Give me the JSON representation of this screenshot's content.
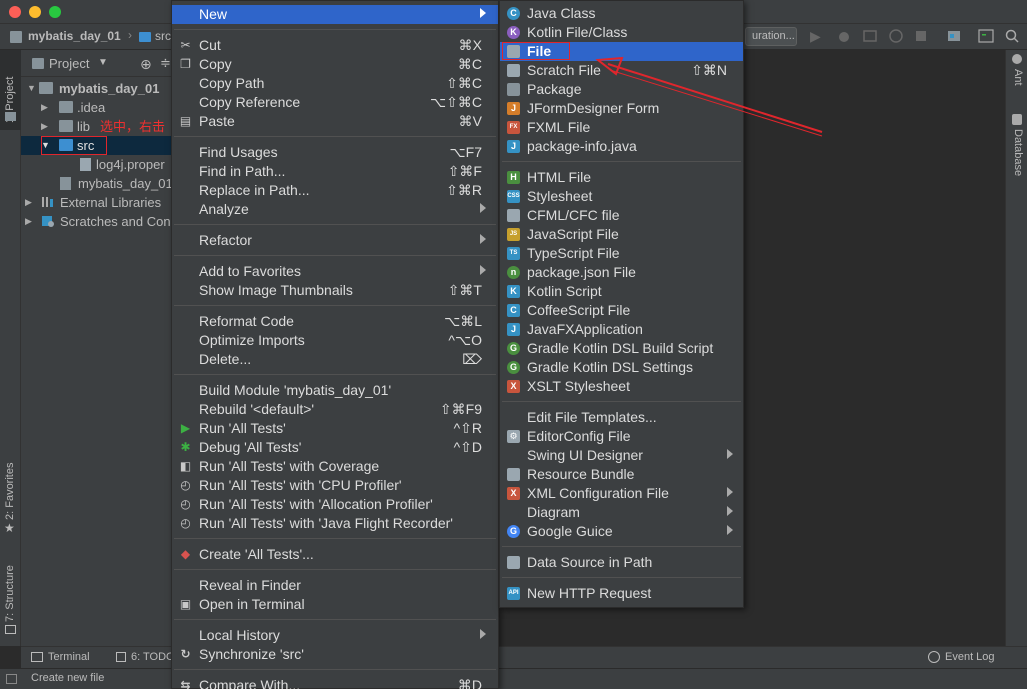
{
  "window": {
    "breadcrumb_project": "mybatis_day_01",
    "breadcrumb_folder": "src",
    "run_config_label": "uration..."
  },
  "left_tool_tabs": [
    "1: Project",
    "2: Favorites",
    "7: Structure"
  ],
  "right_tool_tabs": [
    "Ant",
    "Database"
  ],
  "project_panel": {
    "title": "Project",
    "tree": [
      {
        "label": "mybatis_day_01",
        "depth": 0,
        "expanded": true,
        "bold": true
      },
      {
        "label": ".idea",
        "depth": 1,
        "expanded": false
      },
      {
        "label": "lib",
        "depth": 1,
        "expanded": false
      },
      {
        "label": "src",
        "depth": 1,
        "expanded": true,
        "selected": true
      },
      {
        "label": "log4j.proper",
        "depth": 2
      },
      {
        "label": "mybatis_day_01",
        "depth": 1
      },
      {
        "label": "External Libraries",
        "depth": 0,
        "expanded": false
      },
      {
        "label": "Scratches and Con",
        "depth": 0,
        "expanded": false
      }
    ]
  },
  "annotation_text": "选中，右击",
  "context_menu": {
    "items": [
      {
        "label": "New",
        "shortcut": "",
        "submenu": true,
        "highlighted": true
      },
      {
        "sep": true
      },
      {
        "label": "Cut",
        "shortcut": "⌘X",
        "icon": "scissors-icon"
      },
      {
        "label": "Copy",
        "shortcut": "⌘C",
        "icon": "copy-icon"
      },
      {
        "label": "Copy Path",
        "shortcut": "⇧⌘C"
      },
      {
        "label": "Copy Reference",
        "shortcut": "⌥⇧⌘C"
      },
      {
        "label": "Paste",
        "shortcut": "⌘V",
        "icon": "paste-icon"
      },
      {
        "sep": true
      },
      {
        "label": "Find Usages",
        "shortcut": "⌥F7"
      },
      {
        "label": "Find in Path...",
        "shortcut": "⇧⌘F"
      },
      {
        "label": "Replace in Path...",
        "shortcut": "⇧⌘R"
      },
      {
        "label": "Analyze",
        "shortcut": "",
        "submenu": true
      },
      {
        "sep": true
      },
      {
        "label": "Refactor",
        "shortcut": "",
        "submenu": true
      },
      {
        "sep": true
      },
      {
        "label": "Add to Favorites",
        "shortcut": "",
        "submenu": true
      },
      {
        "label": "Show Image Thumbnails",
        "shortcut": "⇧⌘T"
      },
      {
        "sep": true
      },
      {
        "label": "Reformat Code",
        "shortcut": "⌥⌘L"
      },
      {
        "label": "Optimize Imports",
        "shortcut": "^⌥O"
      },
      {
        "label": "Delete...",
        "shortcut": "⌦"
      },
      {
        "sep": true
      },
      {
        "label": "Build Module 'mybatis_day_01'",
        "shortcut": ""
      },
      {
        "label": "Rebuild '<default>'",
        "shortcut": "⇧⌘F9"
      },
      {
        "label": "Run 'All Tests'",
        "shortcut": "^⇧R",
        "icon": "run-icon"
      },
      {
        "label": "Debug 'All Tests'",
        "shortcut": "^⇧D",
        "icon": "debug-icon"
      },
      {
        "label": "Run 'All Tests' with Coverage",
        "shortcut": "",
        "icon": "coverage-icon"
      },
      {
        "label": "Run 'All Tests' with 'CPU Profiler'",
        "shortcut": "",
        "icon": "profiler-icon"
      },
      {
        "label": "Run 'All Tests' with 'Allocation Profiler'",
        "shortcut": "",
        "icon": "profiler-icon"
      },
      {
        "label": "Run 'All Tests' with 'Java Flight Recorder'",
        "shortcut": "",
        "icon": "profiler-icon"
      },
      {
        "sep": true
      },
      {
        "label": "Create 'All Tests'...",
        "shortcut": "",
        "icon": "create-test-icon"
      },
      {
        "sep": true
      },
      {
        "label": "Reveal in Finder",
        "shortcut": ""
      },
      {
        "label": "Open in Terminal",
        "shortcut": "",
        "icon": "terminal-icon"
      },
      {
        "sep": true
      },
      {
        "label": "Local History",
        "shortcut": "",
        "submenu": true
      },
      {
        "label": "Synchronize 'src'",
        "shortcut": "",
        "icon": "sync-icon"
      },
      {
        "sep": true
      },
      {
        "label": "Compare With...",
        "shortcut": "⌘D",
        "icon": "compare-icon"
      }
    ]
  },
  "new_submenu": {
    "items": [
      {
        "label": "Java Class",
        "icon": "java-class-icon",
        "icolor": "#3592c4",
        "iglyph": "C"
      },
      {
        "label": "Kotlin File/Class",
        "icon": "kotlin-icon",
        "icolor": "#8a5ebf",
        "iglyph": "K"
      },
      {
        "label": "File",
        "icon": "file-icon",
        "icolor": "#9aa7b0",
        "iglyph": "",
        "highlighted": true
      },
      {
        "label": "Scratch File",
        "icon": "scratch-file-icon",
        "icolor": "#9aa7b0",
        "iglyph": "",
        "shortcut": "⇧⌘N"
      },
      {
        "label": "Package",
        "icon": "package-icon",
        "icolor": "#87939a",
        "iglyph": ""
      },
      {
        "label": "JFormDesigner Form",
        "icon": "jform-icon",
        "icolor": "#d47d2a",
        "iglyph": "J"
      },
      {
        "label": "FXML File",
        "icon": "fxml-icon",
        "icolor": "#c8553d",
        "iglyph": "FX"
      },
      {
        "label": "package-info.java",
        "icon": "java-file-icon",
        "icolor": "#3592c4",
        "iglyph": "J"
      },
      {
        "sep": true
      },
      {
        "label": "HTML File",
        "icon": "html-icon",
        "icolor": "#4a8f3f",
        "iglyph": "H"
      },
      {
        "label": "Stylesheet",
        "icon": "css-icon",
        "icolor": "#3592c4",
        "iglyph": "CSS"
      },
      {
        "label": "CFML/CFC file",
        "icon": "cfml-icon",
        "icolor": "#9aa7b0",
        "iglyph": ""
      },
      {
        "label": "JavaScript File",
        "icon": "javascript-icon",
        "icolor": "#c6a02d",
        "iglyph": "JS"
      },
      {
        "label": "TypeScript File",
        "icon": "typescript-icon",
        "icolor": "#3592c4",
        "iglyph": "TS"
      },
      {
        "label": "package.json File",
        "icon": "nodejs-icon",
        "icolor": "#4a8f3f",
        "iglyph": "n"
      },
      {
        "label": "Kotlin Script",
        "icon": "kotlin-script-icon",
        "icolor": "#3592c4",
        "iglyph": "K"
      },
      {
        "label": "CoffeeScript File",
        "icon": "coffeescript-icon",
        "icolor": "#3592c4",
        "iglyph": "C"
      },
      {
        "label": "JavaFXApplication",
        "icon": "javafx-icon",
        "icolor": "#3592c4",
        "iglyph": "J"
      },
      {
        "label": "Gradle Kotlin DSL Build Script",
        "icon": "gradle-icon",
        "icolor": "#4a8f3f",
        "iglyph": "G"
      },
      {
        "label": "Gradle Kotlin DSL Settings",
        "icon": "gradle-icon",
        "icolor": "#4a8f3f",
        "iglyph": "G"
      },
      {
        "label": "XSLT Stylesheet",
        "icon": "xslt-icon",
        "icolor": "#c8553d",
        "iglyph": "X"
      },
      {
        "sep": true
      },
      {
        "label": "Edit File Templates...",
        "icon": "",
        "icolor": "",
        "iglyph": ""
      },
      {
        "label": "EditorConfig File",
        "icon": "gear-icon",
        "icolor": "#9aa7b0",
        "iglyph": "⚙"
      },
      {
        "label": "Swing UI Designer",
        "icon": "",
        "icolor": "",
        "iglyph": "",
        "submenu": true
      },
      {
        "label": "Resource Bundle",
        "icon": "resource-bundle-icon",
        "icolor": "#9aa7b0",
        "iglyph": ""
      },
      {
        "label": "XML Configuration File",
        "icon": "xml-icon",
        "icolor": "#c8553d",
        "iglyph": "X",
        "submenu": true
      },
      {
        "label": "Diagram",
        "icon": "",
        "icolor": "",
        "iglyph": "",
        "submenu": true
      },
      {
        "label": "Google Guice",
        "icon": "google-icon",
        "icolor": "#4285f4",
        "iglyph": "G",
        "submenu": true
      },
      {
        "sep": true
      },
      {
        "label": "Data Source in Path",
        "icon": "database-icon",
        "icolor": "#9aa7b0",
        "iglyph": ""
      },
      {
        "sep": true
      },
      {
        "label": "New HTTP Request",
        "icon": "api-icon",
        "icolor": "#3592c4",
        "iglyph": "API"
      }
    ]
  },
  "bottom_tabs": [
    "Terminal",
    "6: TODO"
  ],
  "event_log": "Event Log",
  "status_text": "Create new file",
  "colors": {
    "highlight": "#2f65ca",
    "annotation_red": "#e0262c"
  }
}
